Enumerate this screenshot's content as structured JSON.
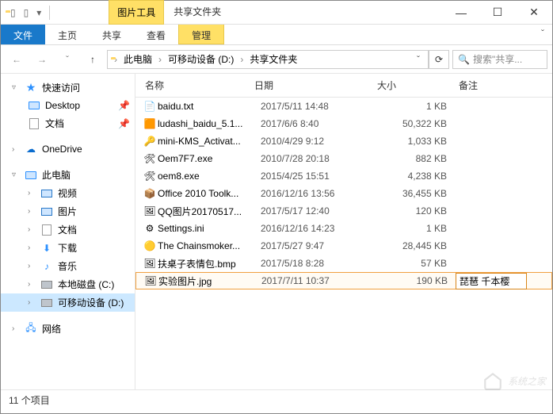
{
  "window": {
    "ctx_tab": "图片工具",
    "ctx_right": "共享文件夹",
    "min": "—",
    "max": "☐",
    "close": "✕"
  },
  "ribbon": {
    "file": "文件",
    "tabs": [
      "主页",
      "共享",
      "查看"
    ],
    "manage": "管理",
    "expand": "ˇ"
  },
  "nav": {
    "back": "←",
    "fwd": "→",
    "recent": "ˇ",
    "up": "↑",
    "refresh": "⟳",
    "crumbs": [
      "此电脑",
      "可移动设备 (D:)",
      "共享文件夹"
    ],
    "search_placeholder": "搜索\"共享..."
  },
  "sidebar": {
    "quick": "快速访问",
    "desktop": "Desktop",
    "docs": "文档",
    "onedrive": "OneDrive",
    "thispc": "此电脑",
    "videos": "视频",
    "pictures": "图片",
    "docs2": "文档",
    "downloads": "下载",
    "music": "音乐",
    "cdisk": "本地磁盘 (C:)",
    "ddisk": "可移动设备 (D:)",
    "network": "网络"
  },
  "columns": {
    "name": "名称",
    "date": "日期",
    "size": "大小",
    "note": "备注"
  },
  "files": [
    {
      "icon": "txt",
      "name": "baidu.txt",
      "date": "2017/5/11 14:48",
      "size": "1 KB",
      "note": ""
    },
    {
      "icon": "exe1",
      "name": "ludashi_baidu_5.1...",
      "date": "2017/6/6 8:40",
      "size": "50,322 KB",
      "note": ""
    },
    {
      "icon": "exe2",
      "name": "mini-KMS_Activat...",
      "date": "2010/4/29 9:12",
      "size": "1,033 KB",
      "note": ""
    },
    {
      "icon": "exe3",
      "name": "Oem7F7.exe",
      "date": "2010/7/28 20:18",
      "size": "882 KB",
      "note": ""
    },
    {
      "icon": "exe3",
      "name": "oem8.exe",
      "date": "2015/4/25 15:51",
      "size": "4,238 KB",
      "note": ""
    },
    {
      "icon": "exe4",
      "name": "Office 2010 Toolk...",
      "date": "2016/12/16 13:56",
      "size": "36,455 KB",
      "note": ""
    },
    {
      "icon": "img",
      "name": "QQ图片20170517...",
      "date": "2017/5/17 12:40",
      "size": "120 KB",
      "note": ""
    },
    {
      "icon": "ini",
      "name": "Settings.ini",
      "date": "2016/12/16 14:23",
      "size": "1 KB",
      "note": ""
    },
    {
      "icon": "exe5",
      "name": "The Chainsmoker...",
      "date": "2017/5/27 9:47",
      "size": "28,445 KB",
      "note": ""
    },
    {
      "icon": "img",
      "name": "扶桌子表情包.bmp",
      "date": "2017/5/18 8:28",
      "size": "57 KB",
      "note": ""
    },
    {
      "icon": "img",
      "name": "实验图片.jpg",
      "date": "2017/7/11 10:37",
      "size": "190 KB",
      "note": "琵琶 千本樱",
      "selected": true,
      "editing": true
    }
  ],
  "status": {
    "count": "11 个项目"
  },
  "watermark": "系统之家"
}
